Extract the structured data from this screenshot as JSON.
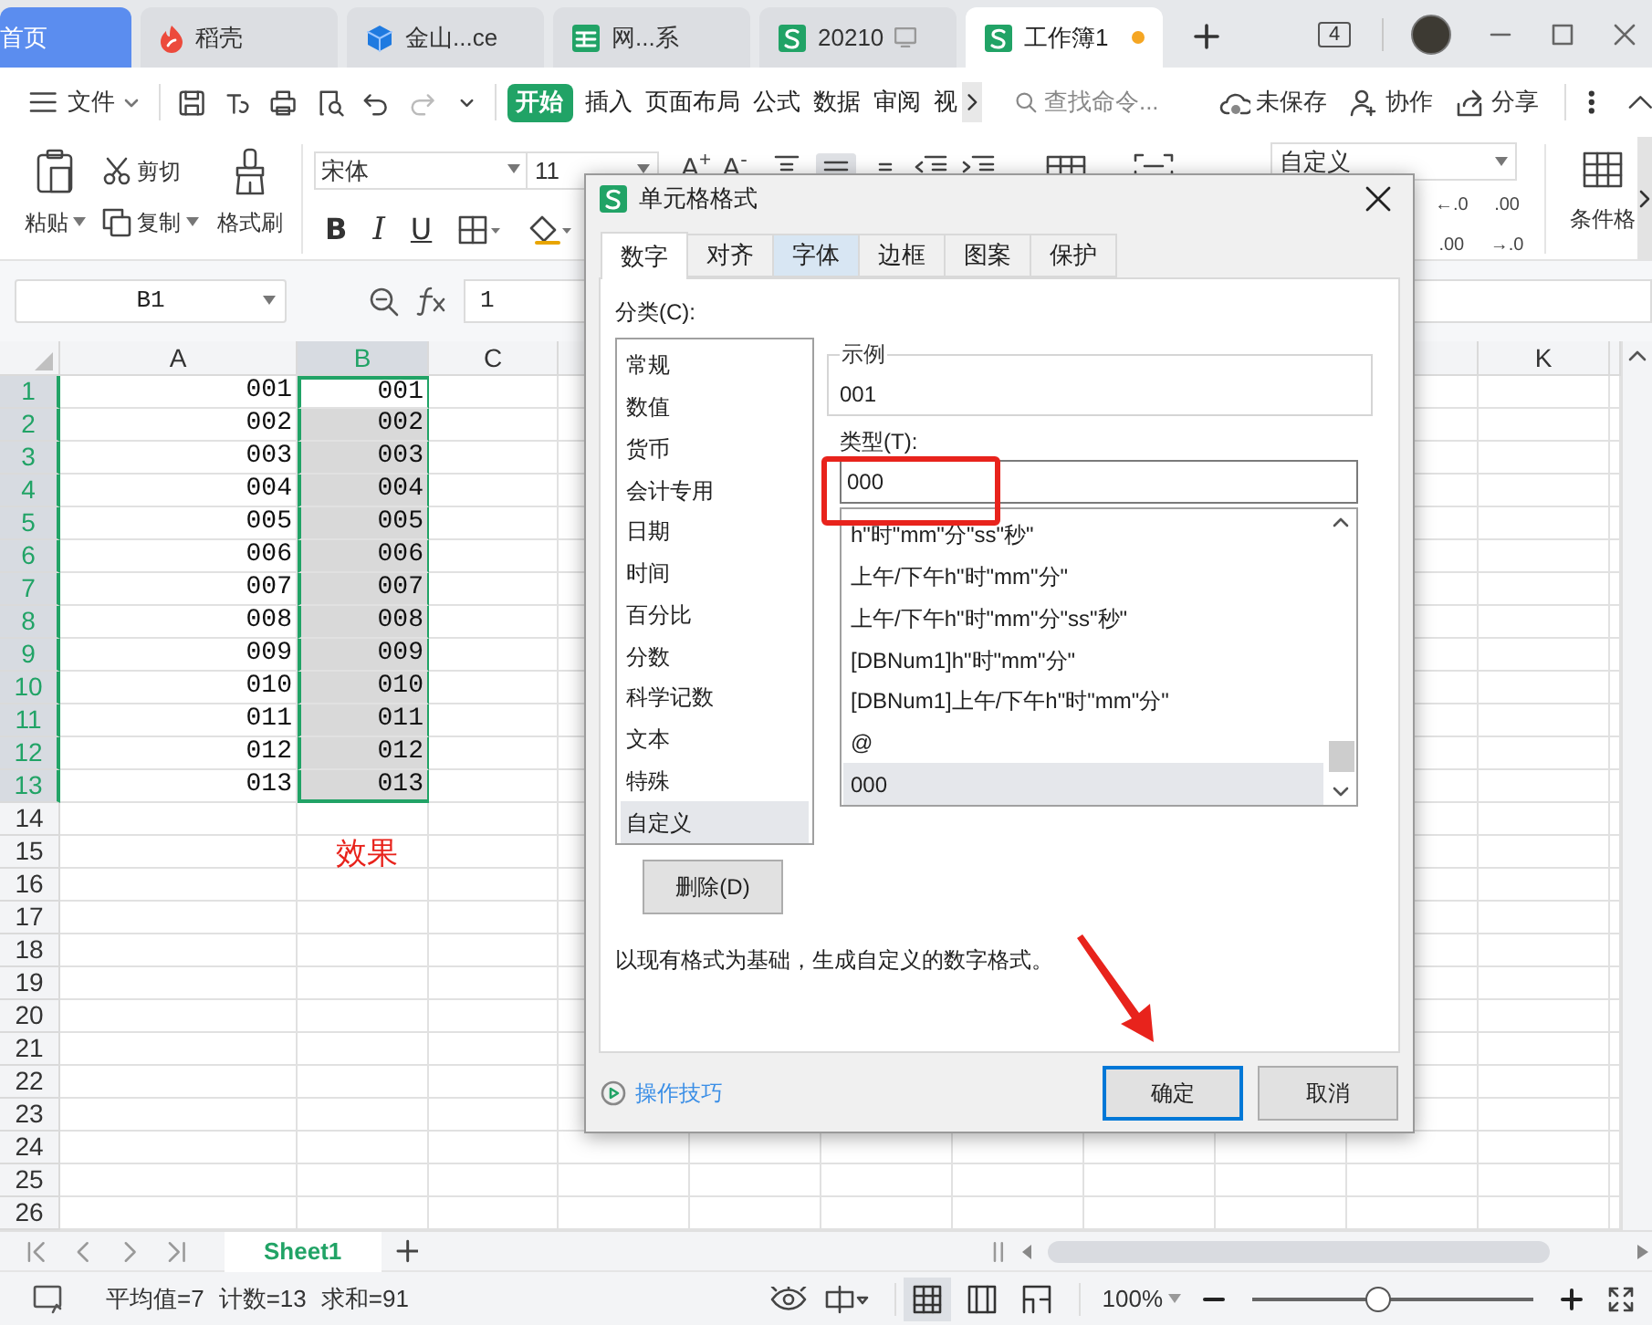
{
  "window_tabs": [
    {
      "label": "首页",
      "kind": "home",
      "selected": false,
      "unsaved": false
    },
    {
      "label": "稻壳",
      "kind": "flame",
      "selected": false,
      "unsaved": false
    },
    {
      "label": "金山...ce",
      "kind": "cube",
      "selected": false,
      "unsaved": false
    },
    {
      "label": "网...系",
      "kind": "grid",
      "selected": false,
      "unsaved": false
    },
    {
      "label": "20210",
      "kind": "sheet-cast",
      "selected": false,
      "unsaved": false
    },
    {
      "label": "工作簿1",
      "kind": "sheet",
      "selected": true,
      "unsaved": true
    }
  ],
  "window_count": "4",
  "menu": {
    "file": "文件",
    "search_placeholder": "查找命令...",
    "actions": [
      "未保存",
      "协作",
      "分享"
    ]
  },
  "ribbon_tabs": [
    {
      "label": "开始",
      "selected": true
    },
    {
      "label": "插入",
      "selected": false
    },
    {
      "label": "页面布局",
      "selected": false
    },
    {
      "label": "公式",
      "selected": false
    },
    {
      "label": "数据",
      "selected": false
    },
    {
      "label": "审阅",
      "selected": false
    },
    {
      "label": "视",
      "selected": false
    }
  ],
  "ribbon": {
    "paste": "粘贴",
    "cut": "剪切",
    "copy": "复制",
    "format_painter": "格式刷",
    "font": "宋体",
    "font_size": "11",
    "grow_font": "A$^{+}$",
    "shrink_font": "A$^{-}$",
    "bold": "B",
    "italic": "I",
    "underline": "U",
    "number_format": "自定义",
    "decimals": [
      [
        "←.0",
        ".00"
      ],
      [
        ".00",
        "→.0"
      ]
    ],
    "conditional_format": "条件格"
  },
  "name_box": "B1",
  "formula": "1",
  "columns": [
    {
      "label": "A",
      "selected": false
    },
    {
      "label": "B",
      "selected": true
    },
    {
      "label": "C",
      "selected": false
    },
    {
      "label": "K",
      "selected": false
    }
  ],
  "rows": [
    {
      "number": "1",
      "selected": true,
      "cells": [
        {
          "text": "001",
          "highlighted": false
        },
        {
          "text": "001",
          "highlighted": false
        }
      ]
    },
    {
      "number": "2",
      "selected": true,
      "cells": [
        {
          "text": "002",
          "highlighted": false
        },
        {
          "text": "002",
          "highlighted": true
        }
      ]
    },
    {
      "number": "3",
      "selected": true,
      "cells": [
        {
          "text": "003",
          "highlighted": false
        },
        {
          "text": "003",
          "highlighted": true
        }
      ]
    },
    {
      "number": "4",
      "selected": true,
      "cells": [
        {
          "text": "004",
          "highlighted": false
        },
        {
          "text": "004",
          "highlighted": true
        }
      ]
    },
    {
      "number": "5",
      "selected": true,
      "cells": [
        {
          "text": "005",
          "highlighted": false
        },
        {
          "text": "005",
          "highlighted": true
        }
      ]
    },
    {
      "number": "6",
      "selected": true,
      "cells": [
        {
          "text": "006",
          "highlighted": false
        },
        {
          "text": "006",
          "highlighted": true
        }
      ]
    },
    {
      "number": "7",
      "selected": true,
      "cells": [
        {
          "text": "007",
          "highlighted": false
        },
        {
          "text": "007",
          "highlighted": true
        }
      ]
    },
    {
      "number": "8",
      "selected": true,
      "cells": [
        {
          "text": "008",
          "highlighted": false
        },
        {
          "text": "008",
          "highlighted": true
        }
      ]
    },
    {
      "number": "9",
      "selected": true,
      "cells": [
        {
          "text": "009",
          "highlighted": false
        },
        {
          "text": "009",
          "highlighted": true
        }
      ]
    },
    {
      "number": "10",
      "selected": true,
      "cells": [
        {
          "text": "010",
          "highlighted": false
        },
        {
          "text": "010",
          "highlighted": true
        }
      ]
    },
    {
      "number": "11",
      "selected": true,
      "cells": [
        {
          "text": "011",
          "highlighted": false
        },
        {
          "text": "011",
          "highlighted": true
        }
      ]
    },
    {
      "number": "12",
      "selected": true,
      "cells": [
        {
          "text": "012",
          "highlighted": false
        },
        {
          "text": "012",
          "highlighted": true
        }
      ]
    },
    {
      "number": "13",
      "selected": true,
      "cells": [
        {
          "text": "013",
          "highlighted": false
        },
        {
          "text": "013",
          "highlighted": true
        }
      ]
    },
    {
      "number": "14",
      "selected": false
    },
    {
      "number": "15",
      "selected": false
    },
    {
      "number": "16",
      "selected": false
    },
    {
      "number": "17",
      "selected": false
    },
    {
      "number": "18",
      "selected": false
    },
    {
      "number": "19",
      "selected": false
    },
    {
      "number": "20",
      "selected": false
    },
    {
      "number": "21",
      "selected": false
    },
    {
      "number": "22",
      "selected": false
    },
    {
      "number": "23",
      "selected": false
    },
    {
      "number": "24",
      "selected": false
    },
    {
      "number": "25",
      "selected": false
    },
    {
      "number": "26",
      "selected": false
    }
  ],
  "annotation": {
    "result_label": "效果"
  },
  "dialog": {
    "title": "单元格格式",
    "tabs": [
      {
        "label": "数字",
        "selected": true,
        "hovered": false
      },
      {
        "label": "对齐",
        "selected": false,
        "hovered": false
      },
      {
        "label": "字体",
        "selected": false,
        "hovered": true
      },
      {
        "label": "边框",
        "selected": false,
        "hovered": false
      },
      {
        "label": "图案",
        "selected": false,
        "hovered": false
      },
      {
        "label": "保护",
        "selected": false,
        "hovered": false
      }
    ],
    "category_label": "分类(C):",
    "categories": [
      {
        "label": "常规",
        "selected": false
      },
      {
        "label": "数值",
        "selected": false
      },
      {
        "label": "货币",
        "selected": false
      },
      {
        "label": "会计专用",
        "selected": false
      },
      {
        "label": "日期",
        "selected": false
      },
      {
        "label": "时间",
        "selected": false
      },
      {
        "label": "百分比",
        "selected": false
      },
      {
        "label": "分数",
        "selected": false
      },
      {
        "label": "科学记数",
        "selected": false
      },
      {
        "label": "文本",
        "selected": false
      },
      {
        "label": "特殊",
        "selected": false
      },
      {
        "label": "自定义",
        "selected": true
      }
    ],
    "sample_label": "示例",
    "sample": "001",
    "type_label": "类型(T):",
    "type_value": "000",
    "types": [
      {
        "label": "h\"时\"mm\"分\"ss\"秒\"",
        "selected": false
      },
      {
        "label": "上午/下午h\"时\"mm\"分\"",
        "selected": false
      },
      {
        "label": "上午/下午h\"时\"mm\"分\"ss\"秒\"",
        "selected": false
      },
      {
        "label": "[DBNum1]h\"时\"mm\"分\"",
        "selected": false
      },
      {
        "label": "[DBNum1]上午/下午h\"时\"mm\"分\"",
        "selected": false
      },
      {
        "label": "@",
        "selected": false
      },
      {
        "label": "000",
        "selected": true
      }
    ],
    "delete_button": "删除(D)",
    "description": "以现有格式为基础，生成自定义的数字格式。",
    "tips_link": "操作技巧",
    "ok_button": "确定",
    "cancel_button": "取消"
  },
  "sheet_tabs": [
    {
      "label": "Sheet1",
      "selected": true
    }
  ],
  "status": {
    "stats": [
      "平均值=7",
      "计数=13",
      "求和=91"
    ],
    "view_modes": [
      {
        "kind": "normal",
        "selected": true
      },
      {
        "kind": "reading",
        "selected": false
      },
      {
        "kind": "page",
        "selected": false
      }
    ],
    "zoom": "100%",
    "zoom_slider": {
      "level": 0.45
    }
  }
}
